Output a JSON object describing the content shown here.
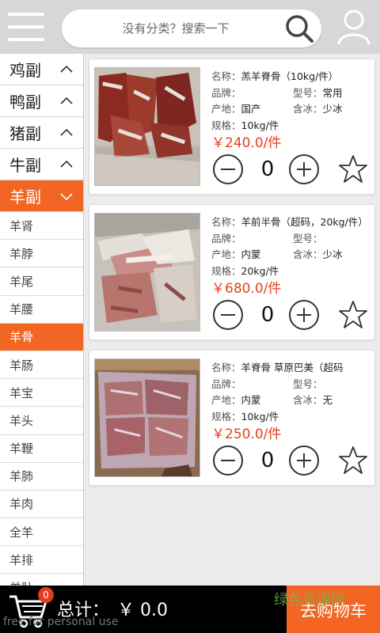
{
  "header": {
    "search_placeholder": "没有分类？搜索一下",
    "menu_icon": "menu-icon",
    "search_icon": "search-icon",
    "user_icon": "user-icon"
  },
  "sidebar": {
    "categories": [
      {
        "label": "鸡副",
        "expanded": false
      },
      {
        "label": "鸭副",
        "expanded": false
      },
      {
        "label": "猪副",
        "expanded": false
      },
      {
        "label": "牛副",
        "expanded": false
      },
      {
        "label": "羊副",
        "expanded": true
      }
    ],
    "subitems": [
      "羊肾",
      "羊脖",
      "羊尾",
      "羊腰",
      "羊骨",
      "羊肠",
      "羊宝",
      "羊头",
      "羊鞭",
      "羊肺",
      "羊肉",
      "全羊",
      "羊排",
      "羊肚"
    ],
    "active_subitem": "羊骨"
  },
  "labels": {
    "name": "名称：",
    "brand": "品牌：",
    "model": "型号：",
    "origin": "产地：",
    "ice": "含冰：",
    "spec": "规格："
  },
  "products": [
    {
      "name": "羔羊脊骨（10kg/件）",
      "brand": "",
      "model": "常用",
      "origin": "国产",
      "ice": "少冰",
      "spec": "10kg/件",
      "price": "￥240.0/件",
      "qty": "0"
    },
    {
      "name": "羊前半骨（超码，20kg/件）",
      "brand": "",
      "model": "",
      "origin": "内蒙",
      "ice": "少冰",
      "spec": "20kg/件",
      "price": "￥680.0/件",
      "qty": "0"
    },
    {
      "name": "羊脊骨 草原巴美（超码",
      "brand": "",
      "model": "",
      "origin": "内蒙",
      "ice": "无",
      "spec": "10kg/件",
      "price": "￥250.0/件",
      "qty": "0"
    }
  ],
  "bottom": {
    "badge": "0",
    "total_label": "总计：",
    "total_value": "￥ 0.0",
    "checkout": "去购物车",
    "watermark": "绿色资源网",
    "footnote": "free for personal use"
  },
  "colors": {
    "accent": "#f26522",
    "price": "#e8401c",
    "badge": "#e53a1e"
  }
}
